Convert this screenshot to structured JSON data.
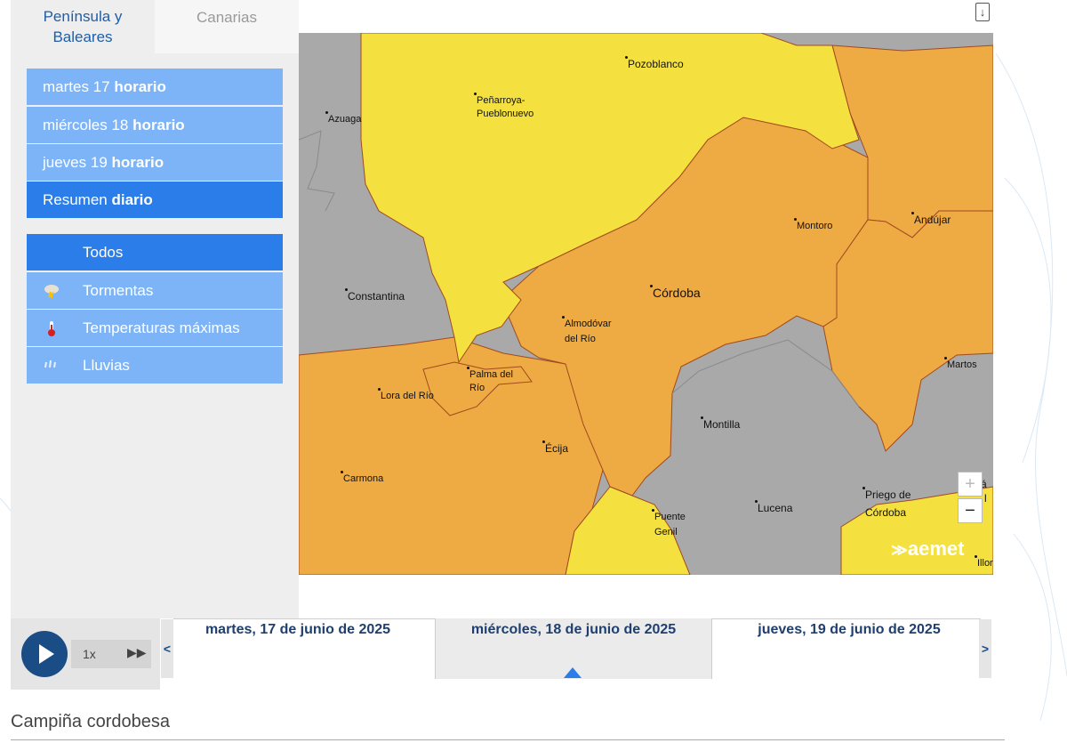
{
  "tabs": {
    "peninsula": "Península y Baleares",
    "canarias": "Canarias"
  },
  "days_menu": [
    {
      "day": "martes 17",
      "mode": "horario",
      "active": false
    },
    {
      "day": "miércoles 18",
      "mode": "horario",
      "active": false
    },
    {
      "day": "jueves 19",
      "mode": "horario",
      "active": false
    },
    {
      "day": "Resumen",
      "mode": "diario",
      "active": true
    }
  ],
  "filters": [
    {
      "label": "Todos",
      "icon": "",
      "active": true
    },
    {
      "label": "Tormentas",
      "icon": "storm-icon",
      "active": false
    },
    {
      "label": "Temperaturas máximas",
      "icon": "thermometer-icon",
      "active": false
    },
    {
      "label": "Lluvias",
      "icon": "rain-icon",
      "active": false
    }
  ],
  "map": {
    "logo": "aemet",
    "zoom_in": "+",
    "zoom_out": "−",
    "colors": {
      "yellow": "#f4e13f",
      "orange": "#eeaa43",
      "gray": "#a9a9a9",
      "border": "#a14a1e"
    },
    "towns": {
      "pozoblanco": "Pozoblanco",
      "penarroya": "Peñarroya-",
      "penarroya2": "Pueblonuevo",
      "azuaga": "Azuaga",
      "montoro": "Montoro",
      "andujar": "Andújar",
      "constantina": "Constantina",
      "cordoba": "Córdoba",
      "almodovar": "Almodóvar",
      "almodovar2": "del Río",
      "martos": "Martos",
      "palma": "Palma del",
      "palma2": "Río",
      "lora": "Lora del Río",
      "montilla": "Montilla",
      "ecija": "Écija",
      "carmona": "Carmona",
      "priego": "Priego de",
      "priego2": "Córdoba",
      "lucena": "Lucena",
      "puente": "Puente",
      "puente2": "Genil",
      "illora": "Illor",
      "edge_a": "á",
      "edge_b": "l"
    }
  },
  "timeline": {
    "speed": "1x",
    "days": [
      "martes, 17 de junio de 2025",
      "miércoles, 18 de junio de 2025",
      "jueves, 19 de junio de 2025"
    ],
    "selected_index": 1,
    "prev": "<",
    "next": ">"
  },
  "zone_title": "Campiña cordobesa"
}
